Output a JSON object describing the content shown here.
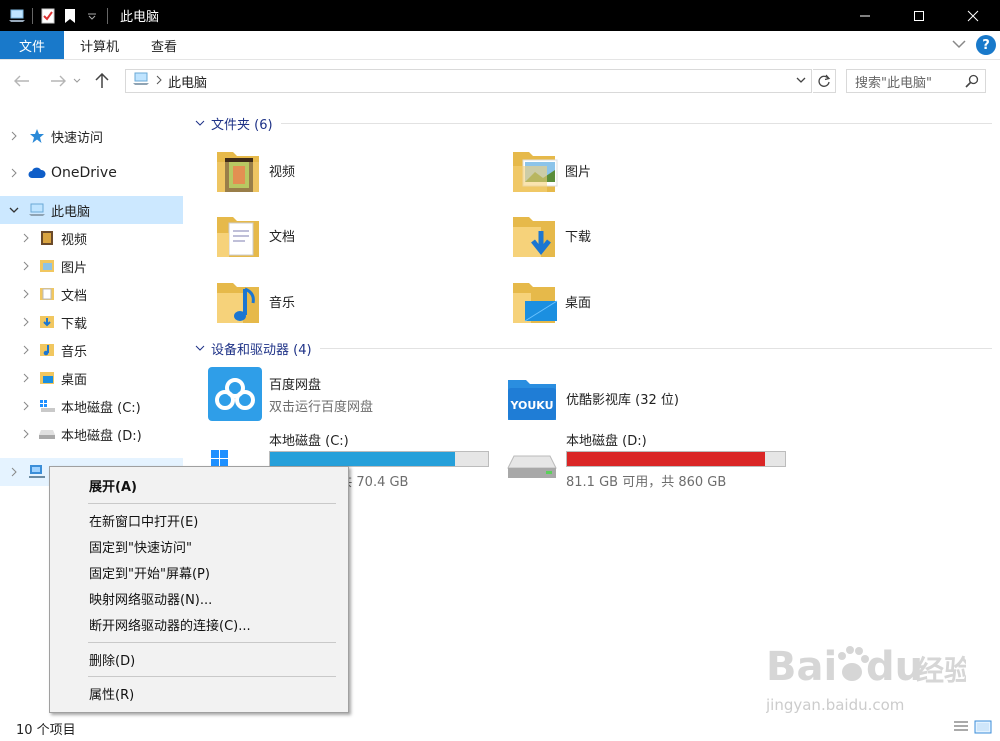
{
  "window": {
    "title": "此电脑"
  },
  "ribbon": {
    "tabs": [
      "文件",
      "计算机",
      "查看"
    ]
  },
  "address": {
    "path": "此电脑"
  },
  "search": {
    "placeholder": "搜索\"此电脑\""
  },
  "nav": {
    "quick_access": "快速访问",
    "onedrive": "OneDrive",
    "this_pc": "此电脑",
    "children": [
      "视频",
      "图片",
      "文档",
      "下载",
      "音乐",
      "桌面",
      "本地磁盘 (C:)",
      "本地磁盘 (D:)"
    ]
  },
  "groups": {
    "folders": "文件夹 (6)",
    "devices": "设备和驱动器 (4)"
  },
  "folders": [
    "视频",
    "图片",
    "文档",
    "下载",
    "音乐",
    "桌面"
  ],
  "apps": [
    {
      "name": "百度网盘",
      "sub": "双击运行百度网盘"
    },
    {
      "name": "优酷影视库 (32 位)"
    }
  ],
  "drives": [
    {
      "name": "本地磁盘 (C:)",
      "sub": ", 共 70.4 GB",
      "used_fraction": 0.85,
      "color": "#26a0da"
    },
    {
      "name": "本地磁盘 (D:)",
      "sub": "81.1 GB 可用，共 860 GB",
      "used_fraction": 0.91,
      "color": "#da2626"
    }
  ],
  "status": {
    "count": "10 个项目"
  },
  "context_menu": {
    "items": [
      "展开(A)",
      "在新窗口中打开(E)",
      "固定到\"快速访问\"",
      "固定到\"开始\"屏幕(P)",
      "映射网络驱动器(N)...",
      "断开网络驱动器的连接(C)...",
      "删除(D)",
      "属性(R)"
    ]
  },
  "colors": {
    "accent": "#1979ca",
    "selection": "#cce8ff",
    "group_header": "#1e3287"
  }
}
